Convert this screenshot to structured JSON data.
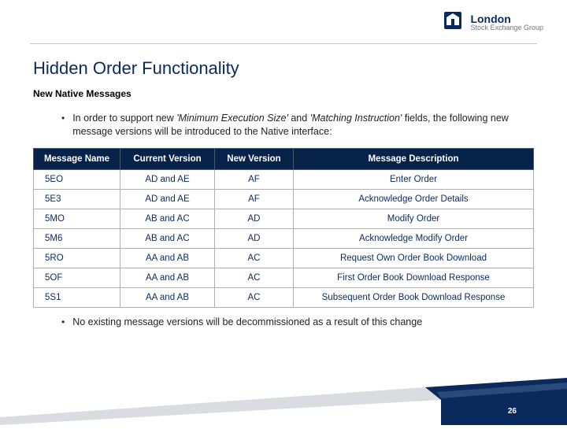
{
  "logo": {
    "main": "London",
    "sub": "Stock Exchange Group"
  },
  "title": "Hidden Order Functionality",
  "subtitle": "New Native Messages",
  "bullet1_pre": "In order to support new ",
  "bullet1_em1": "'Minimum Execution Size'",
  "bullet1_mid": " and ",
  "bullet1_em2": "'Matching Instruction'",
  "bullet1_post": " fields, the following new message versions will be introduced to the Native interface:",
  "table": {
    "headers": [
      "Message Name",
      "Current Version",
      "New Version",
      "Message Description"
    ],
    "rows": [
      {
        "name": "5EO",
        "current": "AD and AE",
        "new": "AF",
        "desc": "Enter Order"
      },
      {
        "name": "5E3",
        "current": "AD and AE",
        "new": "AF",
        "desc": "Acknowledge Order Details"
      },
      {
        "name": "5MO",
        "current": "AB and AC",
        "new": "AD",
        "desc": "Modify Order"
      },
      {
        "name": "5M6",
        "current": "AB and AC",
        "new": "AD",
        "desc": "Acknowledge Modify Order"
      },
      {
        "name": "5RO",
        "current": "AA and AB",
        "new": "AC",
        "desc": "Request Own Order Book Download"
      },
      {
        "name": "5OF",
        "current": "AA and AB",
        "new": "AC",
        "desc": "First Order Book Download Response"
      },
      {
        "name": "5S1",
        "current": "AA and AB",
        "new": "AC",
        "desc": "Subsequent Order Book Download Response"
      }
    ]
  },
  "bullet2": "No existing message versions will be decommissioned as a result of this change",
  "page_number": "26"
}
